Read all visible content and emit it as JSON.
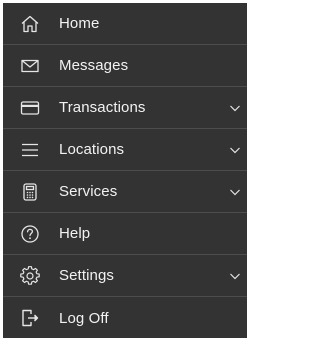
{
  "colors": {
    "background": "#333333",
    "text": "#f2f2f2",
    "divider": "#4d4d4d",
    "icon": "#e6e6e6"
  },
  "menu": {
    "items": [
      {
        "label": "Home",
        "icon": "home-icon",
        "expandable": false
      },
      {
        "label": "Messages",
        "icon": "envelope-icon",
        "expandable": false
      },
      {
        "label": "Transactions",
        "icon": "credit-card-icon",
        "expandable": true
      },
      {
        "label": "Locations",
        "icon": "hamburger-icon",
        "expandable": true
      },
      {
        "label": "Services",
        "icon": "calculator-icon",
        "expandable": true
      },
      {
        "label": "Help",
        "icon": "help-circle-icon",
        "expandable": false
      },
      {
        "label": "Settings",
        "icon": "gear-icon",
        "expandable": true
      },
      {
        "label": "Log Off",
        "icon": "log-off-icon",
        "expandable": false
      }
    ]
  }
}
